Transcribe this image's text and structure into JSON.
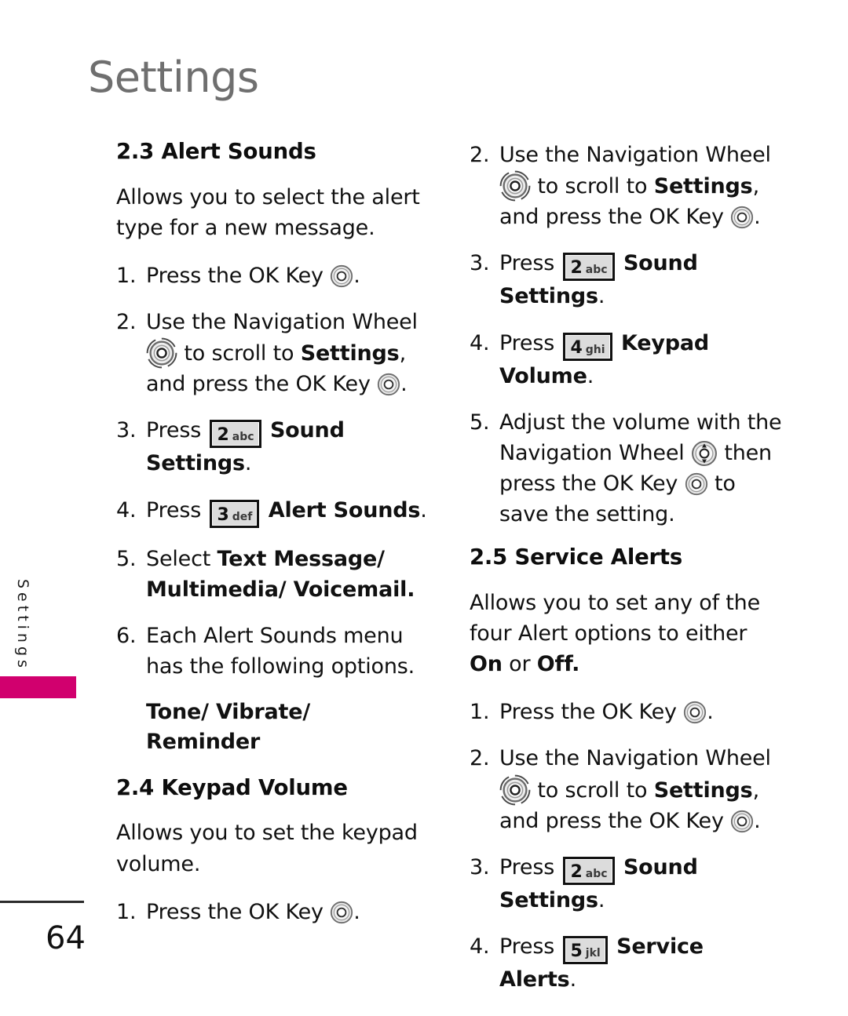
{
  "page": {
    "header_title": "Settings",
    "side_tab_label": "Settings",
    "page_number": "64",
    "accent_color": "#d1006e",
    "header_color": "#6f6f6f"
  },
  "icons": {
    "ok_key": "ok-key-icon",
    "navigation_wheel": "navigation-wheel-icon",
    "navigation_wheel_updown": "navigation-wheel-updown-icon"
  },
  "keys": {
    "two": {
      "number": "2",
      "letters": "abc"
    },
    "three": {
      "number": "3",
      "letters": "def"
    },
    "four": {
      "number": "4",
      "letters": "ghi"
    },
    "five": {
      "number": "5",
      "letters": "jkl"
    }
  },
  "left_column": {
    "section_2_3": {
      "heading": "2.3 Alert Sounds",
      "intro": "Allows you to select the alert type for a new message.",
      "steps": [
        {
          "num": "1.",
          "pre": "Press the OK Key",
          "post": "."
        },
        {
          "num": "2.",
          "pre": "Use the Navigation Wheel",
          "mid": "to scroll to ",
          "bold": "Settings",
          "mid2": ", and press the OK Key",
          "post": "."
        },
        {
          "num": "3.",
          "pre": "Press",
          "bold_after": "Sound Settings",
          "post": "."
        },
        {
          "num": "4.",
          "pre": "Press",
          "bold_after": "Alert Sounds",
          "post": "."
        },
        {
          "num": "5.",
          "pre": "Select ",
          "bold": "Text Message/ Multimedia/ Voicemail",
          "post": "."
        },
        {
          "num": "6.",
          "pre": "Each Alert Sounds menu has the following options."
        }
      ],
      "options_line": "Tone/ Vibrate/ Reminder"
    },
    "section_2_4": {
      "heading": "2.4 Keypad Volume",
      "intro": "Allows you to set the keypad volume.",
      "steps": [
        {
          "num": "1.",
          "pre": "Press the OK Key",
          "post": "."
        }
      ]
    }
  },
  "right_column": {
    "section_2_4_cont": {
      "steps": [
        {
          "num": "2.",
          "pre": "Use the Navigation Wheel",
          "mid": "to scroll to ",
          "bold": "Settings",
          "mid2": ", and press the OK Key",
          "post": "."
        },
        {
          "num": "3.",
          "pre": "Press",
          "bold_after": "Sound Settings",
          "post": "."
        },
        {
          "num": "4.",
          "pre": "Press",
          "bold_after": "Keypad Volume",
          "post": "."
        },
        {
          "num": "5.",
          "pre": "Adjust the volume with the Navigation Wheel",
          "mid": "then press the OK Key",
          "post": "to save the setting."
        }
      ]
    },
    "section_2_5": {
      "heading": "2.5 Service Alerts",
      "intro_a": "Allows you to set any of the four Alert options to either ",
      "intro_on": "On",
      "intro_b": " or ",
      "intro_off": "Off",
      "intro_c": ".",
      "steps": [
        {
          "num": "1.",
          "pre": "Press the OK Key",
          "post": "."
        },
        {
          "num": "2.",
          "pre": "Use the Navigation Wheel",
          "mid": "to scroll to ",
          "bold": "Settings",
          "mid2": ", and press the OK Key",
          "post": "."
        },
        {
          "num": "3.",
          "pre": "Press",
          "bold_after": "Sound Settings",
          "post": "."
        },
        {
          "num": "4.",
          "pre": "Press",
          "bold_after": "Service Alerts",
          "post": "."
        }
      ]
    }
  }
}
